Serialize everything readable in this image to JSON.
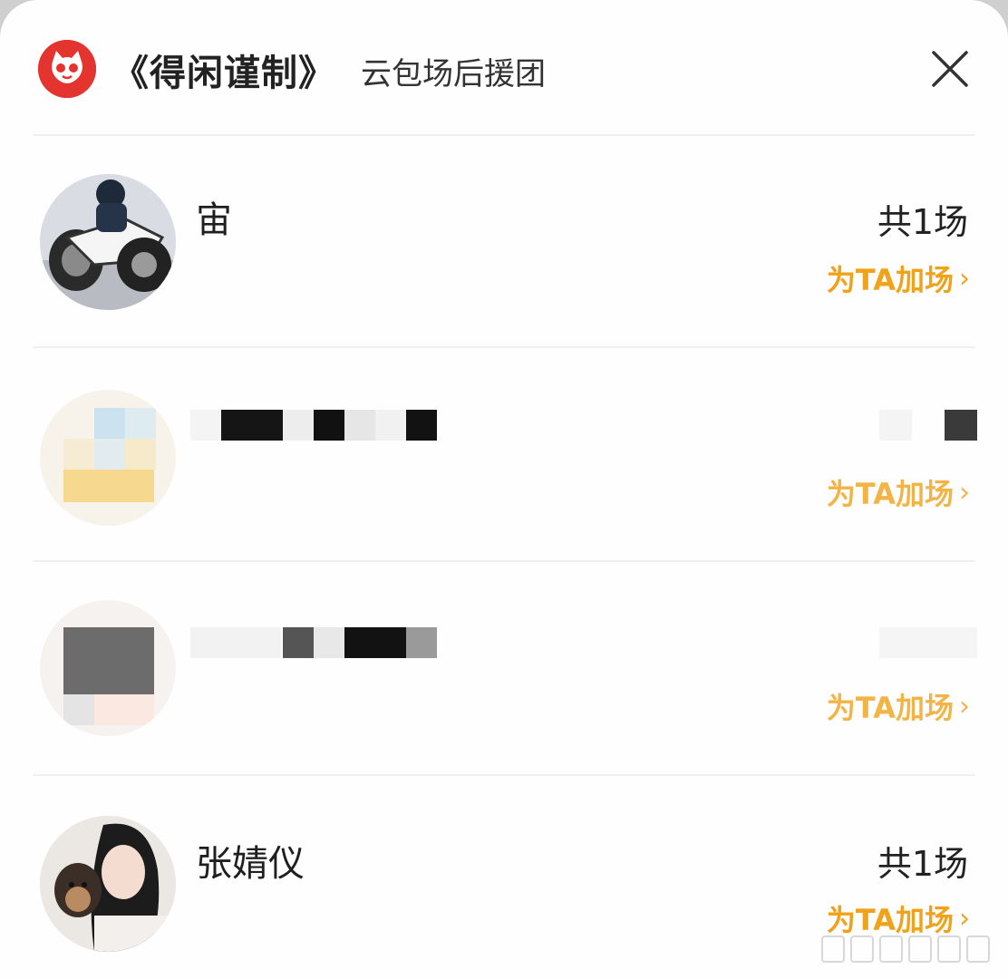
{
  "header": {
    "title": "《得闲谨制》",
    "subtitle": "云包场后援团",
    "close_icon": "close-icon",
    "logo_icon": "cat-logo-icon"
  },
  "supporters": [
    {
      "name": "宙",
      "count": "共1场",
      "add_label": "为TA加场",
      "avatar": "motorcycle-rider-avatar",
      "redacted": false
    },
    {
      "name": "",
      "count": "",
      "add_label": "为TA加场",
      "avatar": "pixelated-avatar",
      "redacted": true
    },
    {
      "name": "",
      "count": "",
      "add_label": "为TA加场",
      "avatar": "pixelated-avatar",
      "redacted": true
    },
    {
      "name": "张婧仪",
      "count": "共1场",
      "add_label": "为TA加场",
      "avatar": "woman-with-dog-avatar",
      "redacted": false
    }
  ],
  "colors": {
    "brand_red": "#e3342f",
    "accent_orange": "#f0a21a"
  }
}
